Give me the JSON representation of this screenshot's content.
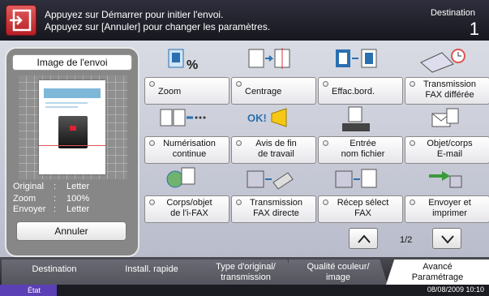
{
  "header": {
    "message_line1": "Appuyez sur Démarrer pour initier l'envoi.",
    "message_line2": "Appuyez sur [Annuler] pour changer les paramètres.",
    "destination_label": "Destination",
    "destination_count": "1"
  },
  "preview": {
    "title": "Image de l'envoi",
    "rows": [
      {
        "key": "Original",
        "sep": ":",
        "value": "Letter"
      },
      {
        "key": "Zoom",
        "sep": ":",
        "value": "100%"
      },
      {
        "key": "Envoyer",
        "sep": ":",
        "value": "Letter"
      }
    ],
    "cancel_label": "Annuler"
  },
  "functions": [
    {
      "line1": "Zoom",
      "line2": "",
      "icon": "zoom-icon"
    },
    {
      "line1": "Centrage",
      "line2": "",
      "icon": "centering-icon"
    },
    {
      "line1": "Effac.bord.",
      "line2": "",
      "icon": "border-erase-icon"
    },
    {
      "line1": "Transmission",
      "line2": "FAX différée",
      "icon": "delayed-fax-icon"
    },
    {
      "line1": "Numérisation",
      "line2": "continue",
      "icon": "continuous-scan-icon"
    },
    {
      "line1": "Avis de fin",
      "line2": "de travail",
      "icon": "job-notice-icon"
    },
    {
      "line1": "Entrée",
      "line2": "nom fichier",
      "icon": "file-name-icon"
    },
    {
      "line1": "Objet/corps",
      "line2": "E-mail",
      "icon": "email-subject-icon"
    },
    {
      "line1": "Corps/objet",
      "line2": "de l'i-FAX",
      "icon": "ifax-subject-icon"
    },
    {
      "line1": "Transmission",
      "line2": "FAX directe",
      "icon": "direct-fax-icon"
    },
    {
      "line1": "Récep sélect",
      "line2": "FAX",
      "icon": "fax-polling-icon"
    },
    {
      "line1": "Envoyer et",
      "line2": "imprimer",
      "icon": "send-print-icon"
    }
  ],
  "paging": {
    "indicator": "1/2"
  },
  "tabs": [
    {
      "line1": "Destination",
      "line2": ""
    },
    {
      "line1": "Install. rapide",
      "line2": ""
    },
    {
      "line1": "Type d'original/",
      "line2": "transmission"
    },
    {
      "line1": "Qualité couleur/",
      "line2": "image"
    },
    {
      "line1": "Avancé",
      "line2": "Paramétrage"
    }
  ],
  "status": {
    "state": "État",
    "datetime": "08/08/2009   10:10"
  }
}
